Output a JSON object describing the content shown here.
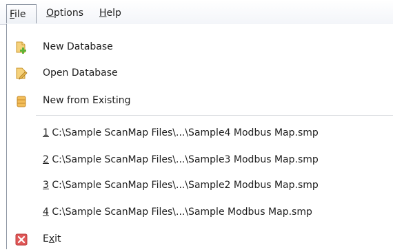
{
  "menubar": {
    "file": {
      "accel": "F",
      "rest": "ile"
    },
    "options": {
      "accel": "O",
      "rest": "ptions"
    },
    "help": {
      "accel": "H",
      "rest": "elp"
    }
  },
  "file_menu": {
    "new_database": {
      "label": "New Database",
      "icon": "new-database-icon"
    },
    "open_database": {
      "label": "Open Database",
      "icon": "open-database-icon"
    },
    "new_from_existing": {
      "label": "New from Existing",
      "icon": "database-icon"
    },
    "recent_files": [
      {
        "accel": "1",
        "path": " C:\\Sample ScanMap Files\\...\\Sample4 Modbus Map.smp"
      },
      {
        "accel": "2",
        "path": " C:\\Sample ScanMap Files\\...\\Sample3 Modbus Map.smp"
      },
      {
        "accel": "3",
        "path": " C:\\Sample ScanMap Files\\...\\Sample2 Modbus Map.smp"
      },
      {
        "accel": "4",
        "path": " C:\\Sample ScanMap Files\\...\\Sample Modbus Map.smp"
      }
    ],
    "exit": {
      "accel": "x",
      "before": "E",
      "after": "it",
      "icon": "exit-icon"
    }
  },
  "colors": {
    "icon_yellow": "#e8b84a",
    "icon_green": "#5fb336",
    "exit_red": "#e05858"
  }
}
